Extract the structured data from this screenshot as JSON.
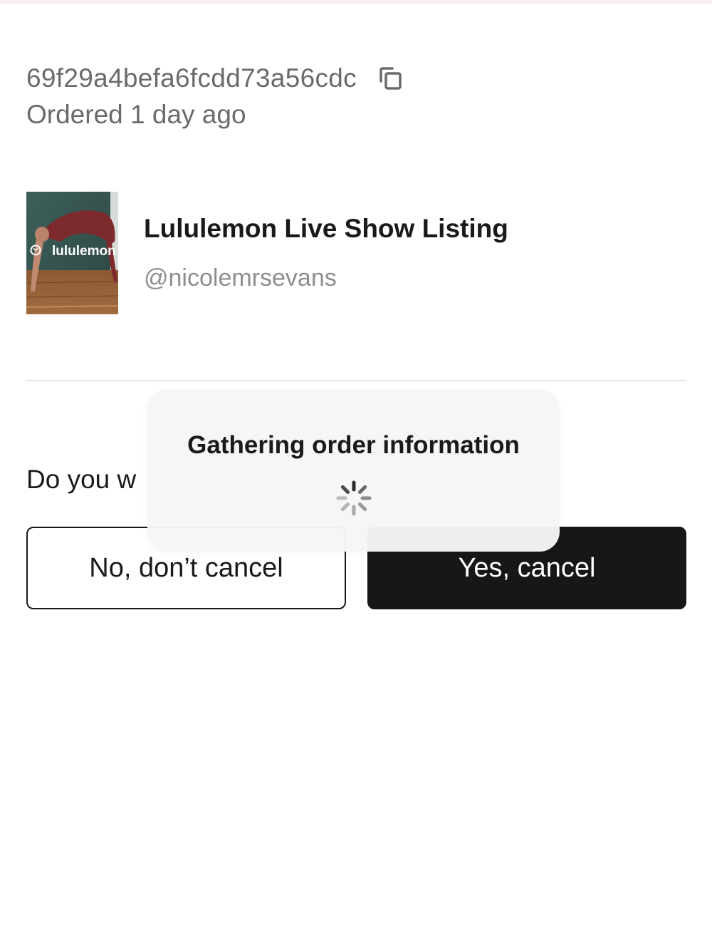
{
  "order": {
    "id": "69f29a4befa6fcdd73a56cdc",
    "ordered_when": "Ordered 1 day ago"
  },
  "product": {
    "title": "Lululemon Live Show Listing",
    "seller": "@nicolemrsevans",
    "thumbnail_brand_text": "lululemon"
  },
  "cancel_dialog": {
    "question_visible": "Do you w",
    "no_label": "No, don’t cancel",
    "yes_label": "Yes, cancel"
  },
  "loading": {
    "message": "Gathering order information"
  },
  "icons": {
    "copy": "copy-icon",
    "spinner": "loading-spinner-icon"
  },
  "colors": {
    "primary_button": "#171717",
    "muted_text": "#6b6b6b",
    "handle_text": "#8e8e8e"
  }
}
